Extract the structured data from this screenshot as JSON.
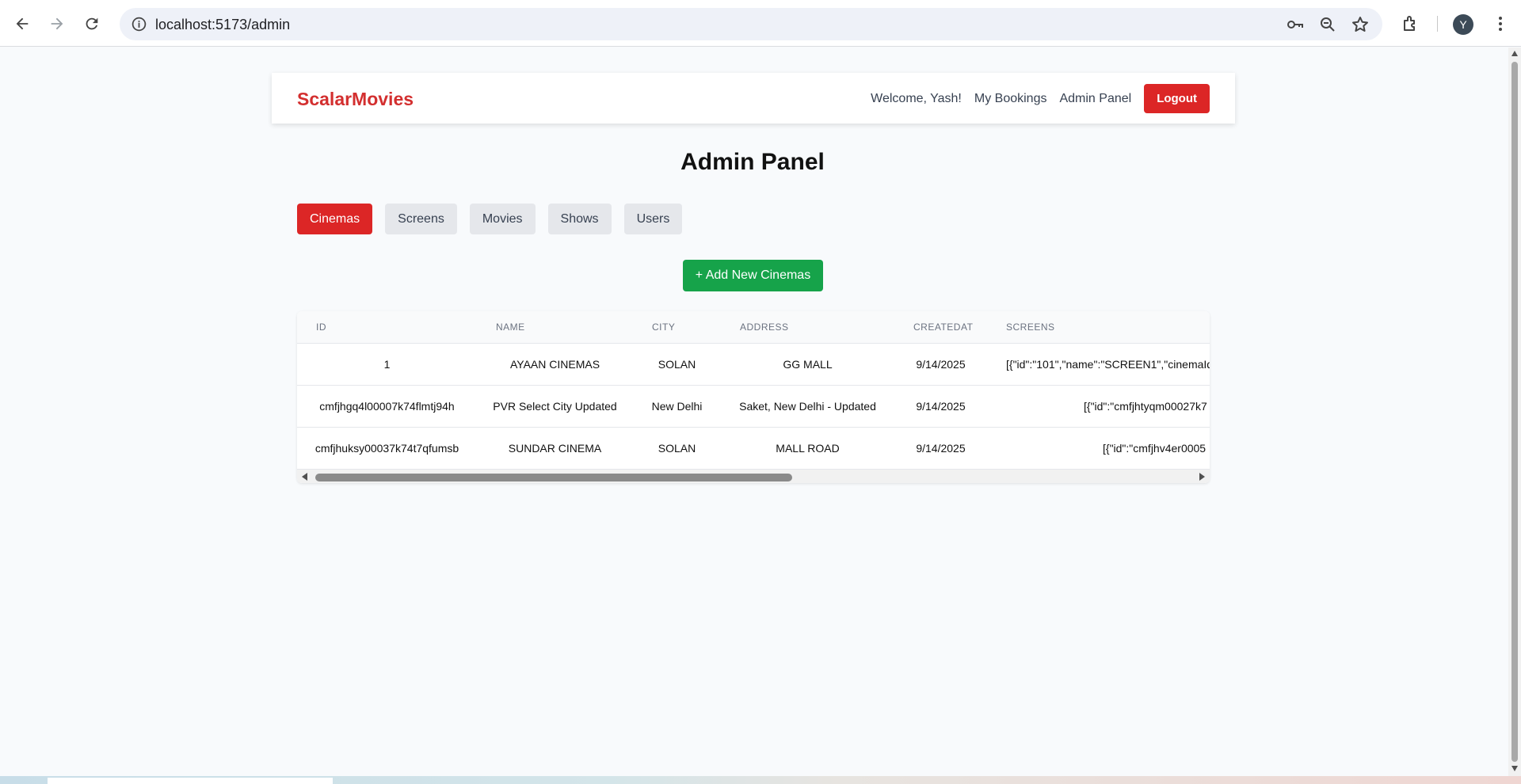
{
  "browser": {
    "url": "localhost:5173/admin",
    "profile_initial": "Y"
  },
  "navbar": {
    "brand": "ScalarMovies",
    "welcome": "Welcome, Yash!",
    "my_bookings": "My Bookings",
    "admin_panel": "Admin Panel",
    "logout": "Logout"
  },
  "page": {
    "title": "Admin Panel",
    "tabs": [
      {
        "label": "Cinemas",
        "active": true
      },
      {
        "label": "Screens",
        "active": false
      },
      {
        "label": "Movies",
        "active": false
      },
      {
        "label": "Shows",
        "active": false
      },
      {
        "label": "Users",
        "active": false
      }
    ],
    "add_button": "+ Add New Cinemas"
  },
  "table": {
    "columns": [
      "ID",
      "NAME",
      "CITY",
      "ADDRESS",
      "CREATEDAT",
      "SCREENS"
    ],
    "rows": [
      {
        "id": "1",
        "name": "AYAAN CINEMAS",
        "city": "SOLAN",
        "address": "GG MALL",
        "createdAt": "9/14/2025",
        "screens": "[{\"id\":\"101\",\"name\":\"SCREEN1\",\"cinemaId\""
      },
      {
        "id": "cmfjhgq4l00007k74flmtj94h",
        "name": "PVR Select City Updated",
        "city": "New Delhi",
        "address": "Saket, New Delhi - Updated",
        "createdAt": "9/14/2025",
        "screens": "[{\"id\":\"cmfjhtyqm00027k7"
      },
      {
        "id": "cmfjhuksy00037k74t7qfumsb",
        "name": "SUNDAR CINEMA",
        "city": "SOLAN",
        "address": "MALL ROAD",
        "createdAt": "9/14/2025",
        "screens": "[{\"id\":\"cmfjhv4er0005"
      }
    ]
  },
  "colors": {
    "brand_red": "#d32f2f",
    "primary_red": "#dc2626",
    "success_green": "#16a34a"
  }
}
